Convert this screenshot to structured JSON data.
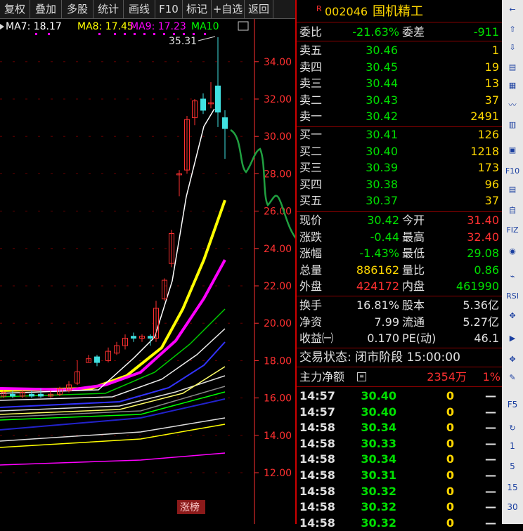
{
  "toolbar": {
    "items": [
      "复权",
      "叠加",
      "多股",
      "统计",
      "画线",
      "F10",
      "标记",
      "+自选",
      "返回"
    ]
  },
  "chart": {
    "ma_labels": {
      "ma7": "MA7: 18.17",
      "ma8": "MA8: 17.45",
      "ma9": "MA9: 17.23",
      "ma10": "MA10"
    },
    "colors": {
      "ma7": "#ffffff",
      "ma8": "#ffff00",
      "ma9": "#ff00ff",
      "ma10": "#00ff00",
      "up": "#ff3030",
      "down": "#40e0e0",
      "axis": "#ff3030",
      "annotation": "#20a040"
    },
    "high_label": "35.31",
    "y_ticks": [
      "34.00",
      "32.00",
      "30.00",
      "28.00",
      "26.00",
      "24.00",
      "22.00",
      "20.00",
      "18.00",
      "16.00",
      "14.00",
      "12.00"
    ],
    "badge": "涨榜"
  },
  "quote": {
    "symbol_mark": "R",
    "code": "002046",
    "name": "国机精工",
    "weibi_label": "委比",
    "weibi_value": "-21.63%",
    "weicha_label": "委差",
    "weicha_value": "-911",
    "asks": [
      {
        "label": "卖五",
        "price": "30.46",
        "vol": "1"
      },
      {
        "label": "卖四",
        "price": "30.45",
        "vol": "19"
      },
      {
        "label": "卖三",
        "price": "30.44",
        "vol": "13"
      },
      {
        "label": "卖二",
        "price": "30.43",
        "vol": "37"
      },
      {
        "label": "卖一",
        "price": "30.42",
        "vol": "2491"
      }
    ],
    "bids": [
      {
        "label": "买一",
        "price": "30.41",
        "vol": "126"
      },
      {
        "label": "买二",
        "price": "30.40",
        "vol": "1218"
      },
      {
        "label": "买三",
        "price": "30.39",
        "vol": "173"
      },
      {
        "label": "买四",
        "price": "30.38",
        "vol": "96"
      },
      {
        "label": "买五",
        "price": "30.37",
        "vol": "37"
      }
    ],
    "stats": [
      {
        "l1": "现价",
        "v1": "30.42",
        "c1": "grn",
        "l2": "今开",
        "v2": "31.40",
        "c2": "red"
      },
      {
        "l1": "涨跌",
        "v1": "-0.44",
        "c1": "grn",
        "l2": "最高",
        "v2": "32.40",
        "c2": "red"
      },
      {
        "l1": "涨幅",
        "v1": "-1.43%",
        "c1": "grn",
        "l2": "最低",
        "v2": "29.08",
        "c2": "grn"
      },
      {
        "l1": "总量",
        "v1": "886162",
        "c1": "yel",
        "l2": "量比",
        "v2": "0.86",
        "c2": "grn"
      },
      {
        "l1": "外盘",
        "v1": "424172",
        "c1": "red",
        "l2": "内盘",
        "v2": "461990",
        "c2": "grn"
      }
    ],
    "fin": [
      {
        "l1": "换手",
        "v1": "16.81%",
        "l2": "股本",
        "v2": "5.36亿"
      },
      {
        "l1": "净资",
        "v1": "7.99",
        "l2": "流通",
        "v2": "5.27亿"
      },
      {
        "l1": "收益㈠",
        "v1": "0.170",
        "l2": "PE(动)",
        "v2": "46.1"
      }
    ],
    "trade_status": "交易状态: 闭市阶段 15:00:00",
    "main_force": {
      "label": "主力净额",
      "value": "2354万",
      "pct": "1%"
    },
    "ticks": [
      {
        "t": "14:57",
        "p": "30.40",
        "v": "0",
        "d": "—"
      },
      {
        "t": "14:57",
        "p": "30.40",
        "v": "0",
        "d": "—"
      },
      {
        "t": "14:58",
        "p": "30.34",
        "v": "0",
        "d": "—"
      },
      {
        "t": "14:58",
        "p": "30.33",
        "v": "0",
        "d": "—"
      },
      {
        "t": "14:58",
        "p": "30.34",
        "v": "0",
        "d": "—"
      },
      {
        "t": "14:58",
        "p": "30.31",
        "v": "0",
        "d": "—"
      },
      {
        "t": "14:58",
        "p": "30.32",
        "v": "0",
        "d": "—"
      },
      {
        "t": "14:58",
        "p": "30.32",
        "v": "0",
        "d": "—"
      },
      {
        "t": "14:58",
        "p": "30.32",
        "v": "0",
        "d": "—"
      }
    ]
  },
  "sidebar": {
    "labels": [
      "F5",
      "1",
      "5",
      "15",
      "30"
    ],
    "rsi": "RSI",
    "f10": "F10",
    "fiz": "FIZ",
    "zi": "自"
  }
}
